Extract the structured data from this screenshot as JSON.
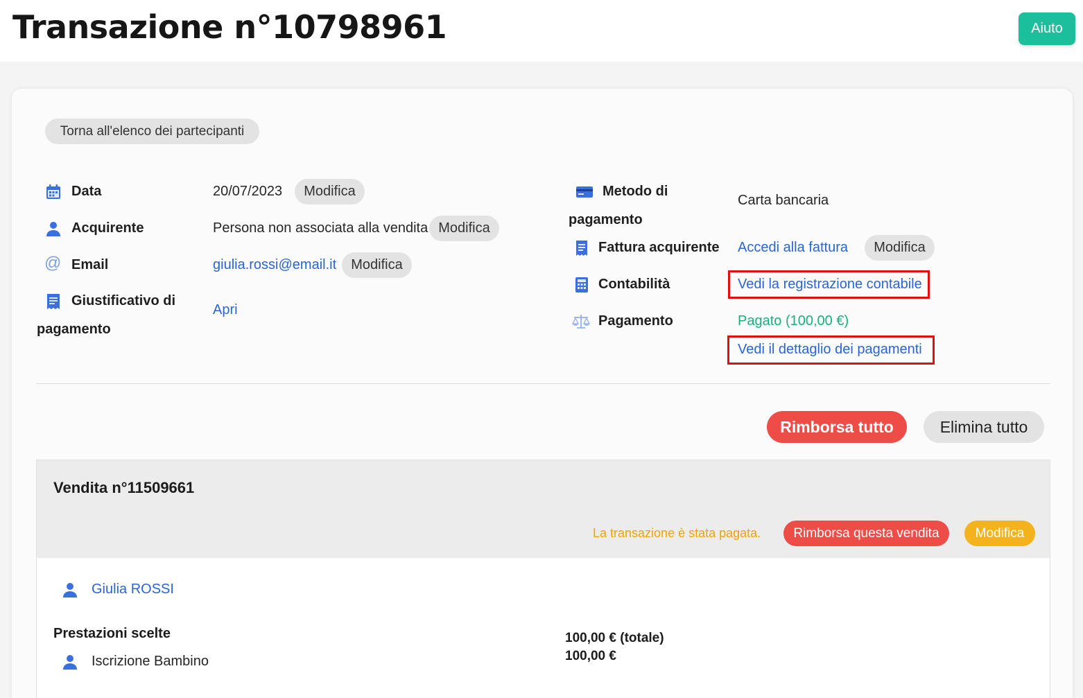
{
  "header": {
    "title": "Transazione n°10798961",
    "help_label": "Aiuto"
  },
  "back_label": "Torna all'elenco dei partecipanti",
  "left_details": {
    "date_label": "Data",
    "date_value": "20/07/2023",
    "date_edit": "Modifica",
    "buyer_label": "Acquirente",
    "buyer_value": "Persona non associata alla vendita",
    "buyer_edit": "Modifica",
    "email_label": "Email",
    "email_value": "giulia.rossi@email.it",
    "email_edit": "Modifica",
    "proof_label_line1": "Giustificativo di",
    "proof_label_line2": "pagamento",
    "proof_value": "Apri"
  },
  "right_details": {
    "method_label_line1": "Metodo di",
    "method_label_line2": "pagamento",
    "method_value": "Carta bancaria",
    "invoice_label": "Fattura acquirente",
    "invoice_value": "Accedi alla fattura",
    "invoice_edit": "Modifica",
    "accounting_label": "Contabilità",
    "accounting_value": "Vedi la registrazione contabile",
    "payment_label": "Pagamento",
    "payment_status": "Pagato (100,00 €)",
    "payment_details": "Vedi il dettaglio dei pagamenti"
  },
  "actions": {
    "refund_all": "Rimborsa tutto",
    "delete_all": "Elimina tutto"
  },
  "sale": {
    "title": "Vendita n°11509661",
    "paid_text": "La transazione è stata pagata.",
    "refund_label": "Rimborsa questa vendita",
    "edit_label": "Modifica",
    "person_name": "Giulia ROSSI",
    "services_title": "Prestazioni scelte",
    "service_name": "Iscrizione Bambino",
    "total": "100,00 € (totale)",
    "amount": "100,00 €"
  },
  "colors": {
    "accent_teal": "#1bbf9c",
    "link_blue": "#2a64d6",
    "danger_red": "#ee4d47",
    "warning_yellow": "#f4b31d",
    "paid_green": "#17b07d",
    "highlight_red": "#e01010"
  },
  "icons": {
    "date": "calendar-icon",
    "buyer": "user-icon",
    "email": "at-sign-icon",
    "proof": "receipt-icon",
    "method": "credit-card-icon",
    "invoice": "receipt-icon",
    "accounting": "calculator-icon",
    "payment": "balance-scale-icon",
    "person": "user-icon"
  }
}
